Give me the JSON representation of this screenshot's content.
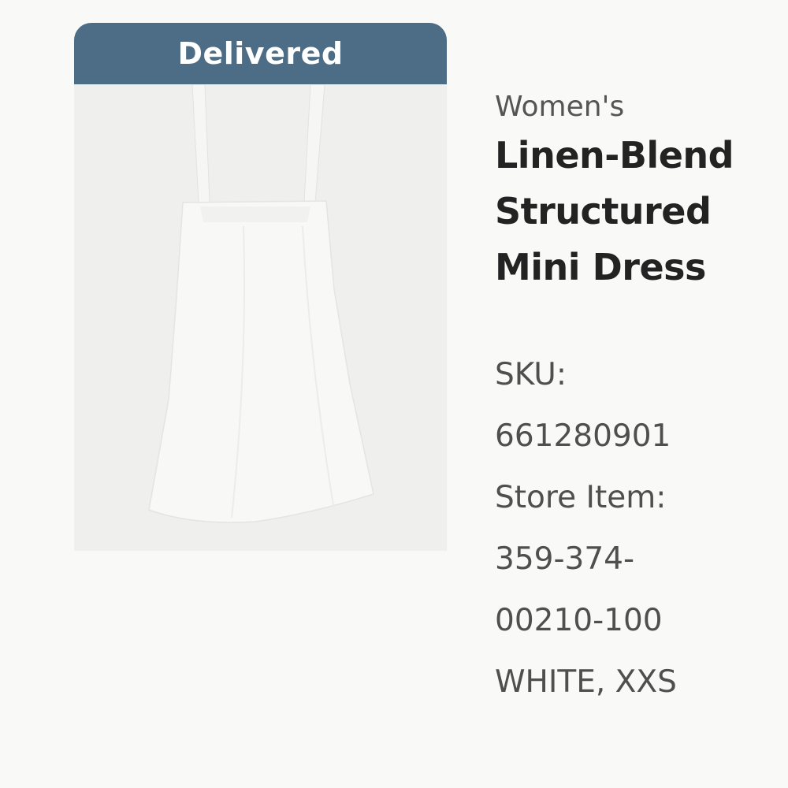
{
  "order_item": {
    "status": "Delivered",
    "category": "Women's",
    "title_lines": [
      "Linen-Blend",
      "Structured",
      "Mini Dress"
    ],
    "sku_label": "SKU:",
    "sku_value": "661280901",
    "store_item_label": "Store Item:",
    "store_item_line1": "359-374-",
    "store_item_line2": "00210-100",
    "variant": "WHITE, XXS",
    "image_icon": "white-mini-dress-photo"
  },
  "colors": {
    "status_banner": "#4c6d85",
    "background": "#f9f9f8",
    "image_background": "#efefee"
  }
}
